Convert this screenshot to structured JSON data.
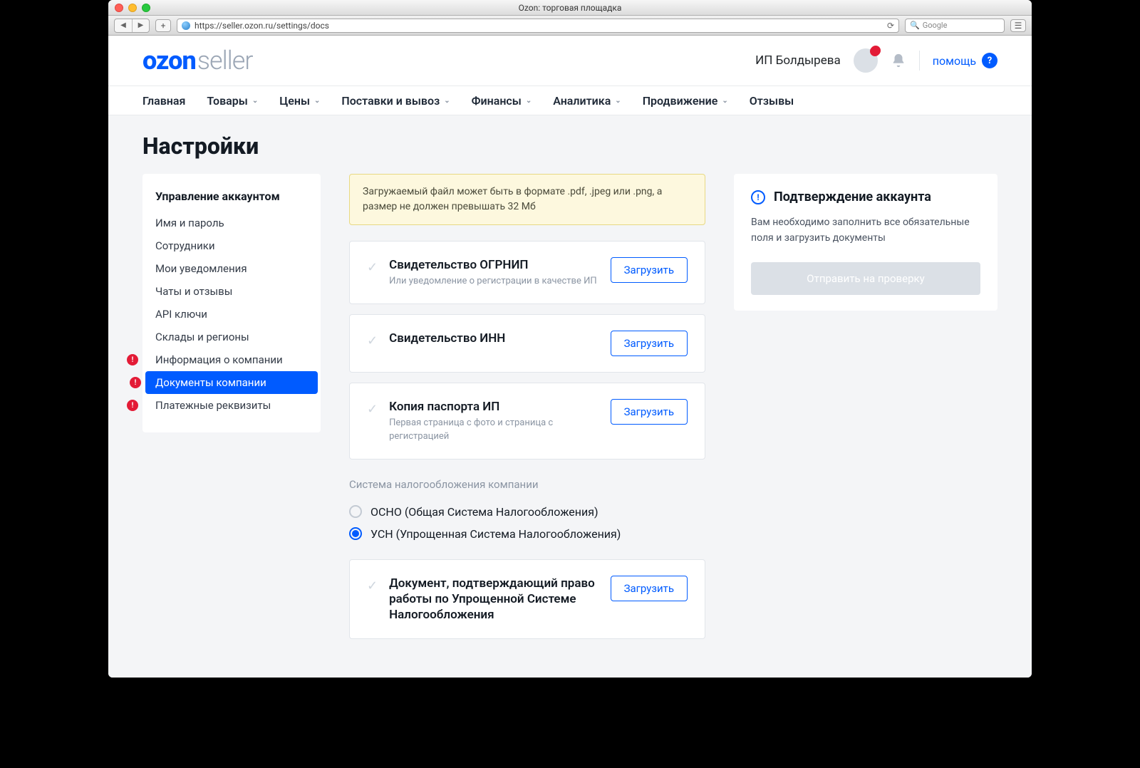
{
  "browser": {
    "title": "Ozon: торговая площадка",
    "url": "https://seller.ozon.ru/settings/docs",
    "search_placeholder": "Google"
  },
  "header": {
    "logo_main": "ozon",
    "logo_sub": "seller",
    "company": "ИП Болдырева",
    "help": "помощь"
  },
  "nav": {
    "items": [
      "Главная",
      "Товары",
      "Цены",
      "Поставки и вывоз",
      "Финансы",
      "Аналитика",
      "Продвижение",
      "Отзывы"
    ],
    "has_chevron": [
      false,
      true,
      true,
      true,
      true,
      true,
      true,
      false
    ]
  },
  "page": {
    "title": "Настройки"
  },
  "sidebar": {
    "section": "Управление аккаунтом",
    "items": [
      {
        "label": "Имя и пароль",
        "alert": false,
        "active": false
      },
      {
        "label": "Сотрудники",
        "alert": false,
        "active": false
      },
      {
        "label": "Мои уведомления",
        "alert": false,
        "active": false
      },
      {
        "label": "Чаты и отзывы",
        "alert": false,
        "active": false
      },
      {
        "label": "API ключи",
        "alert": false,
        "active": false
      },
      {
        "label": "Склады и регионы",
        "alert": false,
        "active": false
      },
      {
        "label": "Информация о компании",
        "alert": true,
        "active": false
      },
      {
        "label": "Документы компании",
        "alert": true,
        "active": true
      },
      {
        "label": "Платежные реквизиты",
        "alert": true,
        "active": false
      }
    ]
  },
  "content": {
    "info_box": "Загружаемый файл может быть в формате .pdf, .jpeg или .png, а размер не должен превышать 32 Мб",
    "upload_btn": "Загрузить",
    "docs": [
      {
        "title": "Свидетельство ОГРНИП",
        "sub": "Или уведомление о регистрации в качестве ИП"
      },
      {
        "title": "Свидетельство ИНН",
        "sub": ""
      },
      {
        "title": "Копия паспорта ИП",
        "sub": "Первая страница с фото и страница с регистрацией"
      }
    ],
    "tax_heading": "Система налогообложения компании",
    "tax_options": [
      {
        "label": "ОСНО (Общая Система Налогообложения)",
        "checked": false
      },
      {
        "label": "УСН (Упрощенная Система Налогообложения)",
        "checked": true
      }
    ],
    "tax_doc": {
      "title": "Документ, подтверждающий право работы по Упрощенной Системе Налогообложения",
      "sub": ""
    }
  },
  "panel": {
    "title": "Подтверждение аккаунта",
    "text": "Вам необходимо заполнить все обязательные поля и загрузить документы",
    "button": "Отправить на проверку"
  }
}
